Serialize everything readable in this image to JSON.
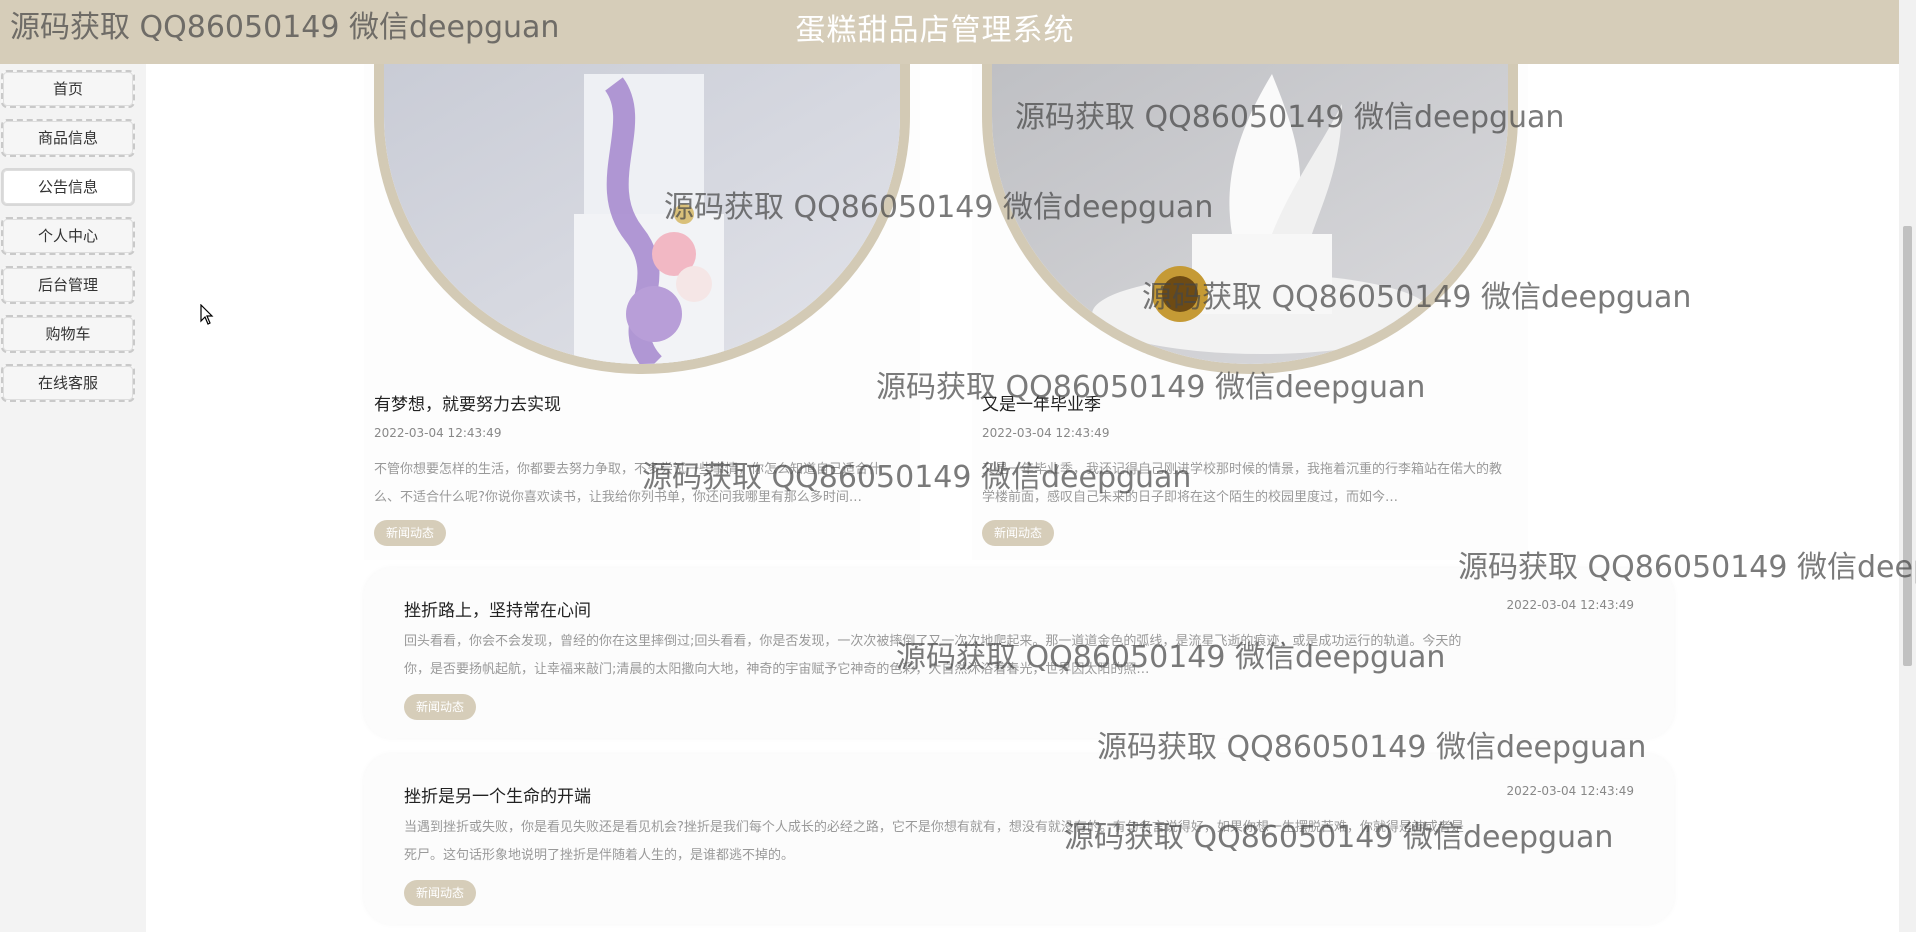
{
  "header": {
    "title": "蛋糕甜品店管理系统"
  },
  "sidebar": {
    "items": [
      {
        "label": "首页"
      },
      {
        "label": "商品信息"
      },
      {
        "label": "公告信息"
      },
      {
        "label": "个人中心"
      },
      {
        "label": "后台管理"
      },
      {
        "label": "购物车"
      },
      {
        "label": "在线客服"
      }
    ],
    "active": "公告信息"
  },
  "cards": [
    {
      "title": "有梦想，就要努力去实现",
      "date": "2022-03-04 12:43:49",
      "desc": "不管你想要怎样的生活，你都要去努力争取，不多尝试一些事情，你怎么知道自己适合什么、不适合什么呢?你说你喜欢读书，让我给你列书单，你还问我哪里有那么多时间…",
      "tag": "新闻动态"
    },
    {
      "title": "又是一年毕业季",
      "date": "2022-03-04 12:43:49",
      "desc": "又是一年毕业季，我还记得自己刚进学校那时候的情景，我拖着沉重的行李箱站在偌大的教学楼前面，感叹自己未来的日子即将在这个陌生的校园里度过，而如今…",
      "tag": "新闻动态"
    }
  ],
  "list": [
    {
      "title": "挫折路上，坚持常在心间",
      "date": "2022-03-04 12:43:49",
      "desc": "回头看看，你会不会发现，曾经的你在这里摔倒过;回头看看，你是否发现，一次次被摔倒了又一次次地爬起来。那一道道金色的弧线，是流星飞逝的痕迹，或是成功运行的轨道。今天的你，是否要扬帆起航，让幸福来敲门;清晨的太阳撒向大地，神奇的宇宙赋予它神奇的色彩，大自然沐浴着春光，世界因太阳的照…",
      "tag": "新闻动态"
    },
    {
      "title": "挫折是另一个生命的开端",
      "date": "2022-03-04 12:43:49",
      "desc": "当遇到挫折或失败，你是看见失败还是看见机会?挫折是我们每个人成长的必经之路，它不是你想有就有，想没有就没有的。有句名言说得好，如果你想一生摆脱苦难，你就得是神或者是死尸。这句话形象地说明了挫折是伴随着人生的，是谁都逃不掉的。",
      "tag": "新闻动态"
    }
  ],
  "watermark": {
    "text": "源码获取 QQ86050149 微信deepguan",
    "partial": "源码获取 QQ86050149 微信deep"
  },
  "colors": {
    "accent": "#d6cdb9",
    "background": "#ffffff",
    "sidebar": "#f3f3f3"
  }
}
